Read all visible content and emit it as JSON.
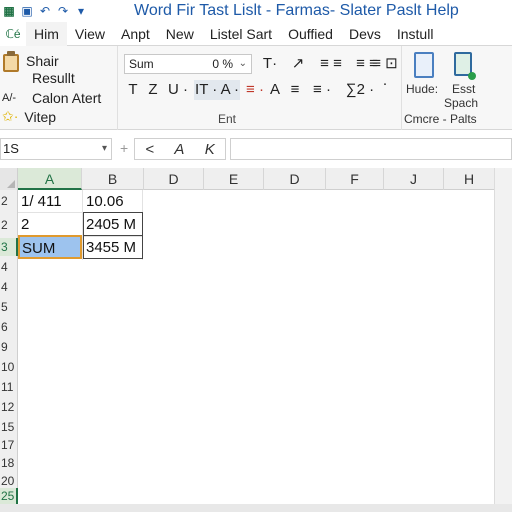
{
  "titlebar": {
    "title": "Word  Fir  Tast Lislt - Farmas- Slater Paslt Help",
    "icons": [
      "excel-logo-icon",
      "save-icon",
      "undo-icon",
      "redo-icon",
      "customize-icon"
    ]
  },
  "ribbon_tabs": [
    "Him",
    "View",
    "Anpt",
    "New",
    "Listel Sart",
    "Ouffied",
    "Devs",
    "Instull"
  ],
  "ribbon_tabs_first": "ℂé",
  "clipboard": {
    "items": [
      "Shair",
      "Resullt",
      "Calon Atert",
      "Vitep"
    ],
    "left_glyphs": [
      "",
      "",
      "A/-",
      ""
    ]
  },
  "font_group": {
    "font_name": "Sum",
    "font_size": "0 %",
    "row1_tools": [
      "T·",
      "↗",
      "≡ ≡",
      "≡ ≡",
      "≡ ⊡ ·"
    ],
    "row2_tools": [
      "T",
      "Z",
      "U ·",
      "IT · A ·",
      "≡ ·",
      "A",
      "≡",
      "≡ ·",
      "∑2 ·"
    ],
    "label": "Ent"
  },
  "cells_group": {
    "items": [
      "Hude:",
      "Esst",
      "Spach"
    ],
    "label": "Cmcre - Palts"
  },
  "formula_bar": {
    "name_box": "1S",
    "separator": "+",
    "buttons": [
      "<",
      "A",
      "K"
    ],
    "formula": ""
  },
  "grid": {
    "columns": [
      "A",
      "B",
      "D",
      "E",
      "D",
      "F",
      "J",
      "H"
    ],
    "selected_column": "A",
    "rows": [
      "2",
      "2",
      "3",
      "4",
      "4",
      "5",
      "6",
      "9",
      "10",
      "11",
      "12",
      "15",
      "17",
      "18",
      "20",
      "25",
      "25"
    ],
    "selected_row_labels": [
      "3",
      "25"
    ],
    "cells": {
      "a1": "1/ 411",
      "b1": "10.06",
      "a2": "2",
      "b2": "2405 M",
      "a3": "SUM",
      "b3": "3455 M"
    }
  }
}
